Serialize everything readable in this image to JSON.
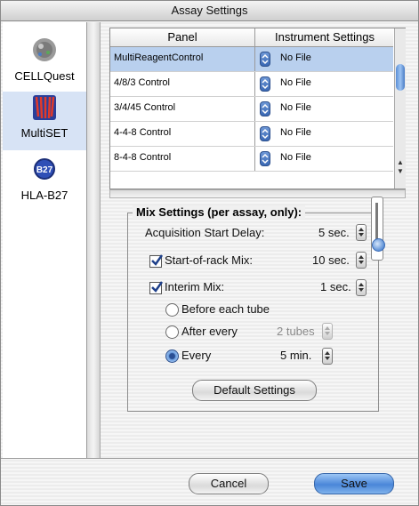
{
  "window": {
    "title": "Assay Settings"
  },
  "sidebar": {
    "items": [
      {
        "label": "CELLQuest",
        "icon": "cellquest-icon",
        "selected": false
      },
      {
        "label": "MultiSET",
        "icon": "multiset-icon",
        "selected": true
      },
      {
        "label": "HLA-B27",
        "icon": "b27-icon",
        "icon_text": "B27",
        "selected": false
      }
    ]
  },
  "table": {
    "columns": [
      "Panel",
      "Instrument Settings"
    ],
    "rows": [
      {
        "panel": "MultiReagentControl",
        "settings": "No File",
        "selected": true
      },
      {
        "panel": "4/8/3 Control",
        "settings": "No File",
        "selected": false
      },
      {
        "panel": "3/4/45 Control",
        "settings": "No File",
        "selected": false
      },
      {
        "panel": "4-4-8 Control",
        "settings": "No File",
        "selected": false
      },
      {
        "panel": "8-4-8 Control",
        "settings": "No File",
        "selected": false
      }
    ]
  },
  "mix": {
    "title": "Mix Settings (per assay, only):",
    "acq_label": "Acquisition Start Delay:",
    "acq_value": "5 sec.",
    "start_label": "Start-of-rack Mix:",
    "start_value": "10 sec.",
    "start_checked": true,
    "interim_label": "Interim Mix:",
    "interim_value": "1 sec.",
    "interim_checked": true,
    "radio_before": "Before each tube",
    "radio_after": "After every",
    "after_value": "2 tubes",
    "radio_every": "Every",
    "every_value": "5 min.",
    "selected_radio": "every",
    "default_button": "Default Settings"
  },
  "footer": {
    "cancel": "Cancel",
    "save": "Save"
  },
  "colors": {
    "selection": "#b9d0ee",
    "accent": "#4a86d8"
  }
}
